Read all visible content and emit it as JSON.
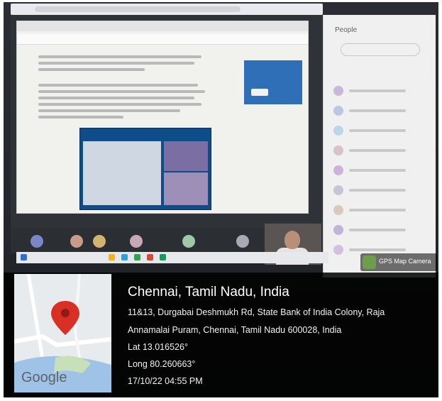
{
  "meet": {
    "people_title": "People"
  },
  "map": {
    "provider": "Google",
    "pin_color": "#d93025"
  },
  "badge": {
    "label": "GPS Map Camera"
  },
  "location": {
    "city": "Chennai, Tamil Nadu, India",
    "address_line1": "11&13, Durgabai Deshmukh Rd, State Bank of India Colony, Raja",
    "address_line2": "Annamalai Puram, Chennai, Tamil Nadu 600028, India",
    "lat": "Lat 13.016526°",
    "long": "Long 80.260663°",
    "datetime": "17/10/22 04:55 PM"
  }
}
